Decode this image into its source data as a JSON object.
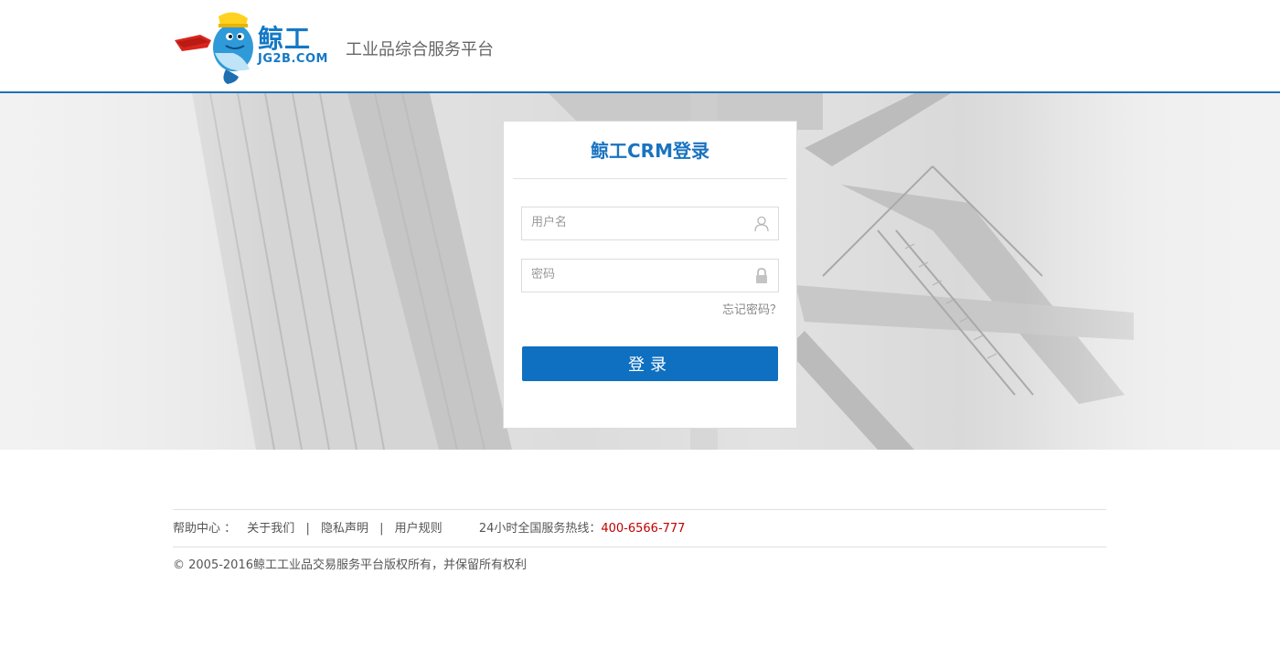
{
  "header": {
    "logo_cn": "鲸工",
    "logo_en": "JG2B.COM",
    "slogan": "工业品综合服务平台"
  },
  "login": {
    "title": "鲸工CRM登录",
    "username_placeholder": "用户名",
    "username_value": "",
    "password_placeholder": "密码",
    "password_value": "",
    "forgot_label": "忘记密码？",
    "submit_label": "登录"
  },
  "footer": {
    "help_label": "帮助中心 ：",
    "links": [
      "关于我们",
      "隐私声明",
      "用户规则"
    ],
    "separator": "|",
    "hotline_label": "24小时全国服务热线：",
    "hotline_number": "400-6566-777",
    "copyright": "© 2005-2016鲸工工业品交易服务平台版权所有，并保留所有权利"
  },
  "icons": {
    "username": "user-icon",
    "password": "lock-icon"
  },
  "colors": {
    "brand_blue": "#1479c6",
    "button_blue": "#0f6fc0",
    "header_border": "#1f72b8",
    "hotline_red": "#c00000"
  }
}
